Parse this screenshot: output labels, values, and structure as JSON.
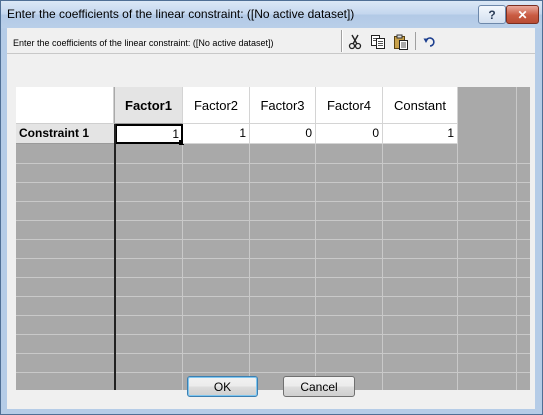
{
  "window": {
    "title": "Enter the coefficients of the linear constraint: ([No active dataset])",
    "help_label": "?",
    "close_label": "✕"
  },
  "header": {
    "subtitle": "Enter the coefficients of the linear constraint: ([No active dataset])"
  },
  "toolbar": {
    "icons": [
      "cut-icon",
      "copy-icon",
      "paste-icon",
      "undo-icon"
    ]
  },
  "grid": {
    "columns": [
      "Factor1",
      "Factor2",
      "Factor3",
      "Factor4",
      "Constant"
    ],
    "rows": [
      {
        "label": "Constraint 1",
        "values": [
          "1",
          "1",
          "0",
          "0",
          "1"
        ]
      }
    ]
  },
  "buttons": {
    "ok_label": "OK",
    "cancel_label": "Cancel"
  }
}
